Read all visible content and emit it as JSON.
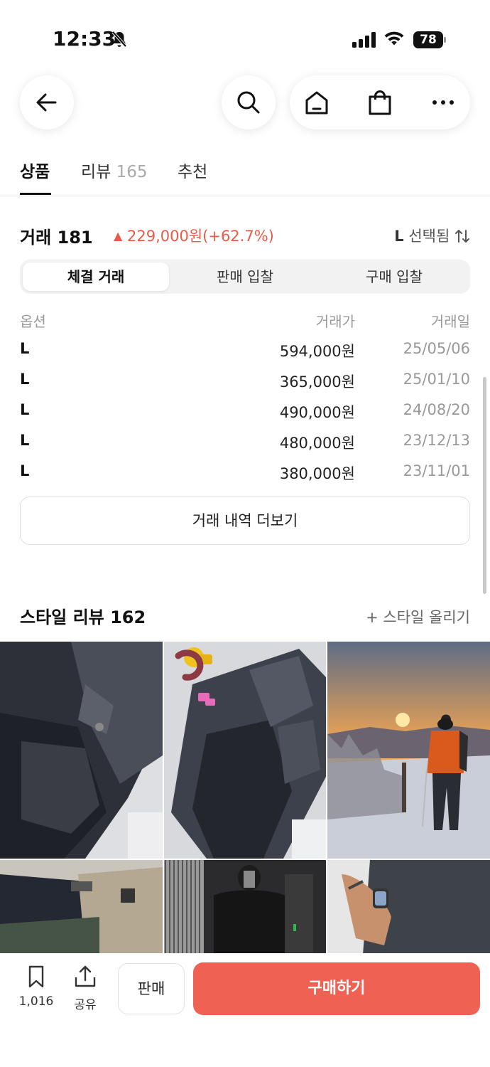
{
  "status_bar": {
    "time": "12:33",
    "battery": "78"
  },
  "tabs": [
    {
      "label": "상품",
      "count": ""
    },
    {
      "label": "리뷰",
      "count": "165"
    },
    {
      "label": "추천",
      "count": ""
    }
  ],
  "trade": {
    "title": "거래 181",
    "change_arrow": "▲",
    "change": "229,000원(+62.7%)",
    "size_selected": "L",
    "size_selected_suffix": "선택됨",
    "segments": [
      "체결 거래",
      "판매 입찰",
      "구매 입찰"
    ],
    "columns": {
      "option": "옵션",
      "price": "거래가",
      "date": "거래일"
    },
    "rows": [
      {
        "option": "L",
        "price": "594,000원",
        "date": "25/05/06"
      },
      {
        "option": "L",
        "price": "365,000원",
        "date": "25/01/10"
      },
      {
        "option": "L",
        "price": "490,000원",
        "date": "24/08/20"
      },
      {
        "option": "L",
        "price": "480,000원",
        "date": "23/12/13"
      },
      {
        "option": "L",
        "price": "380,000원",
        "date": "23/11/01"
      }
    ],
    "more_label": "거래 내역 더보기"
  },
  "style_review": {
    "title": "스타일 리뷰 162",
    "upload_label": "+ 스타일 올리기"
  },
  "bottom_bar": {
    "bookmark_count": "1,016",
    "share_label": "공유",
    "sell_label": "판매",
    "buy_label": "구매하기"
  },
  "colors": {
    "accent": "#ef6253",
    "price_up": "#ea5a48"
  },
  "icons": [
    "back-arrow-icon",
    "search-icon",
    "home-icon",
    "shopping-bag-icon",
    "more-icon",
    "bookmark-icon",
    "share-icon",
    "sort-icon"
  ]
}
